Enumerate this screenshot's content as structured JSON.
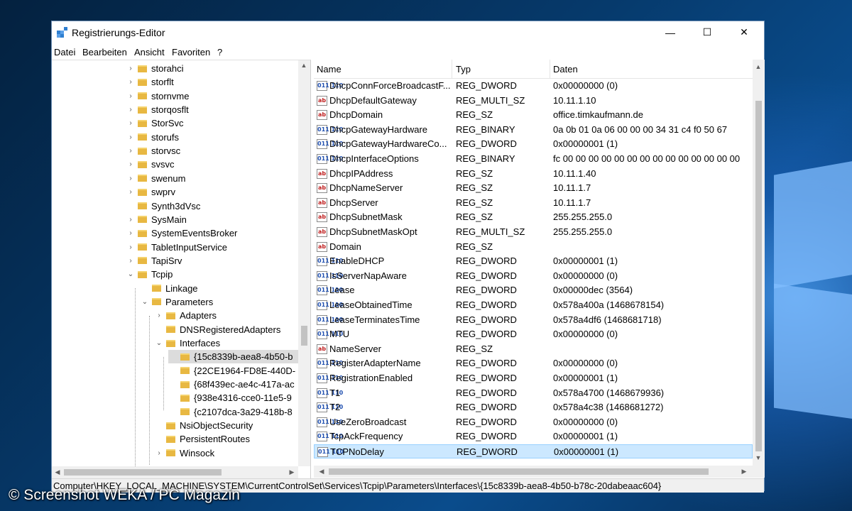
{
  "window": {
    "title": "Registrierungs-Editor",
    "minimize": "—",
    "maximize": "☐",
    "close": "✕"
  },
  "menu": [
    "Datei",
    "Bearbeiten",
    "Ansicht",
    "Favoriten",
    "?"
  ],
  "tree": [
    {
      "label": "storahci",
      "level": 0,
      "exp": "›"
    },
    {
      "label": "storflt",
      "level": 0,
      "exp": "›"
    },
    {
      "label": "stornvme",
      "level": 0,
      "exp": "›"
    },
    {
      "label": "storqosflt",
      "level": 0,
      "exp": "›"
    },
    {
      "label": "StorSvc",
      "level": 0,
      "exp": "›"
    },
    {
      "label": "storufs",
      "level": 0,
      "exp": "›"
    },
    {
      "label": "storvsc",
      "level": 0,
      "exp": "›"
    },
    {
      "label": "svsvc",
      "level": 0,
      "exp": "›"
    },
    {
      "label": "swenum",
      "level": 0,
      "exp": "›"
    },
    {
      "label": "swprv",
      "level": 0,
      "exp": "›"
    },
    {
      "label": "Synth3dVsc",
      "level": 0,
      "exp": ""
    },
    {
      "label": "SysMain",
      "level": 0,
      "exp": "›"
    },
    {
      "label": "SystemEventsBroker",
      "level": 0,
      "exp": "›"
    },
    {
      "label": "TabletInputService",
      "level": 0,
      "exp": "›"
    },
    {
      "label": "TapiSrv",
      "level": 0,
      "exp": "›"
    },
    {
      "label": "Tcpip",
      "level": 0,
      "exp": "⌄"
    },
    {
      "label": "Linkage",
      "level": 1,
      "exp": ""
    },
    {
      "label": "Parameters",
      "level": 1,
      "exp": "⌄"
    },
    {
      "label": "Adapters",
      "level": 2,
      "exp": "›"
    },
    {
      "label": "DNSRegisteredAdapters",
      "level": 2,
      "exp": ""
    },
    {
      "label": "Interfaces",
      "level": 2,
      "exp": "⌄"
    },
    {
      "label": "{15c8339b-aea8-4b50-b",
      "level": 3,
      "exp": "",
      "selected": true
    },
    {
      "label": "{22CE1964-FD8E-440D-",
      "level": 3,
      "exp": ""
    },
    {
      "label": "{68f439ec-ae4c-417a-ac",
      "level": 3,
      "exp": ""
    },
    {
      "label": "{938e4316-cce0-11e5-9",
      "level": 3,
      "exp": ""
    },
    {
      "label": "{c2107dca-3a29-418b-8",
      "level": 3,
      "exp": ""
    },
    {
      "label": "NsiObjectSecurity",
      "level": 2,
      "exp": ""
    },
    {
      "label": "PersistentRoutes",
      "level": 2,
      "exp": ""
    },
    {
      "label": "Winsock",
      "level": 2,
      "exp": "›"
    }
  ],
  "list": {
    "headers": {
      "name": "Name",
      "type": "Typ",
      "data": "Daten"
    },
    "rows": [
      {
        "icon": "bin",
        "name": "DhcpConnForceBroadcastF...",
        "type": "REG_DWORD",
        "data": "0x00000000 (0)"
      },
      {
        "icon": "sz",
        "name": "DhcpDefaultGateway",
        "type": "REG_MULTI_SZ",
        "data": "10.11.1.10"
      },
      {
        "icon": "sz",
        "name": "DhcpDomain",
        "type": "REG_SZ",
        "data": "office.timkaufmann.de"
      },
      {
        "icon": "bin",
        "name": "DhcpGatewayHardware",
        "type": "REG_BINARY",
        "data": "0a 0b 01 0a 06 00 00 00 34 31 c4 f0 50 67"
      },
      {
        "icon": "bin",
        "name": "DhcpGatewayHardwareCo...",
        "type": "REG_DWORD",
        "data": "0x00000001 (1)"
      },
      {
        "icon": "bin",
        "name": "DhcpInterfaceOptions",
        "type": "REG_BINARY",
        "data": "fc 00 00 00 00 00 00 00 00 00 00 00 00 00 00"
      },
      {
        "icon": "sz",
        "name": "DhcpIPAddress",
        "type": "REG_SZ",
        "data": "10.11.1.40"
      },
      {
        "icon": "sz",
        "name": "DhcpNameServer",
        "type": "REG_SZ",
        "data": "10.11.1.7"
      },
      {
        "icon": "sz",
        "name": "DhcpServer",
        "type": "REG_SZ",
        "data": "10.11.1.7"
      },
      {
        "icon": "sz",
        "name": "DhcpSubnetMask",
        "type": "REG_SZ",
        "data": "255.255.255.0"
      },
      {
        "icon": "sz",
        "name": "DhcpSubnetMaskOpt",
        "type": "REG_MULTI_SZ",
        "data": "255.255.255.0"
      },
      {
        "icon": "sz",
        "name": "Domain",
        "type": "REG_SZ",
        "data": ""
      },
      {
        "icon": "bin",
        "name": "EnableDHCP",
        "type": "REG_DWORD",
        "data": "0x00000001 (1)"
      },
      {
        "icon": "bin",
        "name": "IsServerNapAware",
        "type": "REG_DWORD",
        "data": "0x00000000 (0)"
      },
      {
        "icon": "bin",
        "name": "Lease",
        "type": "REG_DWORD",
        "data": "0x00000dec (3564)"
      },
      {
        "icon": "bin",
        "name": "LeaseObtainedTime",
        "type": "REG_DWORD",
        "data": "0x578a400a (1468678154)"
      },
      {
        "icon": "bin",
        "name": "LeaseTerminatesTime",
        "type": "REG_DWORD",
        "data": "0x578a4df6 (1468681718)"
      },
      {
        "icon": "bin",
        "name": "MTU",
        "type": "REG_DWORD",
        "data": "0x00000000 (0)"
      },
      {
        "icon": "sz",
        "name": "NameServer",
        "type": "REG_SZ",
        "data": ""
      },
      {
        "icon": "bin",
        "name": "RegisterAdapterName",
        "type": "REG_DWORD",
        "data": "0x00000000 (0)"
      },
      {
        "icon": "bin",
        "name": "RegistrationEnabled",
        "type": "REG_DWORD",
        "data": "0x00000001 (1)"
      },
      {
        "icon": "bin",
        "name": "T1",
        "type": "REG_DWORD",
        "data": "0x578a4700 (1468679936)"
      },
      {
        "icon": "bin",
        "name": "T2",
        "type": "REG_DWORD",
        "data": "0x578a4c38 (1468681272)"
      },
      {
        "icon": "bin",
        "name": "UseZeroBroadcast",
        "type": "REG_DWORD",
        "data": "0x00000000 (0)"
      },
      {
        "icon": "bin",
        "name": "TcpAckFrequency",
        "type": "REG_DWORD",
        "data": "0x00000001 (1)"
      },
      {
        "icon": "bin",
        "name": "TCPNoDelay",
        "type": "REG_DWORD",
        "data": "0x00000001 (1)",
        "selected": true
      }
    ]
  },
  "icons": {
    "sz": "ab",
    "bin": "011 110"
  },
  "status": "Computer\\HKEY_LOCAL_MACHINE\\SYSTEM\\CurrentControlSet\\Services\\Tcpip\\Parameters\\Interfaces\\{15c8339b-aea8-4b50-b78c-20dabeaac604}",
  "watermark": "© Screenshot WEKA / PC Magazin"
}
